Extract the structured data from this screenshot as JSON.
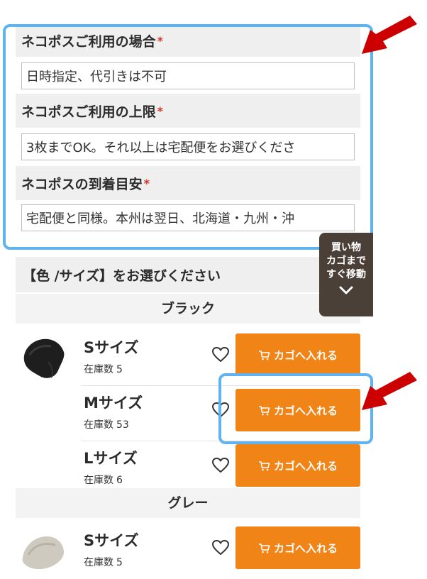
{
  "colors": {
    "accent_orange": "#f08417",
    "highlight_blue": "#5fb3f0",
    "arrow_red": "#cc0000",
    "required_star": "#d9342b",
    "float_bg": "#4a4038"
  },
  "fields": [
    {
      "label": "ネコポスご利用の場合",
      "required_mark": "*",
      "value": "日時指定、代引きは不可"
    },
    {
      "label": "ネコポスご利用の上限",
      "required_mark": "*",
      "value": "3枚までOK。それ以上は宅配便をお選びくださ"
    },
    {
      "label": "ネコポスの到着目安",
      "required_mark": "*",
      "value": "宅配便と同様。本州は翌日、北海道・九州・沖"
    }
  ],
  "floating_cart": {
    "line1": "買い物",
    "line2": "カゴまで",
    "line3": "すぐ移動",
    "icon": "chevron-down-icon"
  },
  "selection": {
    "heading": "【色 /サイズ】をお選びください",
    "groups": [
      {
        "color_name": "ブラック",
        "image": "black-beanie-thumbnail",
        "items": [
          {
            "size": "Sサイズ",
            "stock_label": "在庫数",
            "stock": "5",
            "button_label": "カゴへ入れる"
          },
          {
            "size": "Mサイズ",
            "stock_label": "在庫数",
            "stock": "53",
            "button_label": "カゴへ入れる"
          },
          {
            "size": "Lサイズ",
            "stock_label": "在庫数",
            "stock": "6",
            "button_label": "カゴへ入れる"
          }
        ]
      },
      {
        "color_name": "グレー",
        "image": "gray-beanie-thumbnail",
        "items": [
          {
            "size": "Sサイズ",
            "stock_label": "在庫数",
            "stock": "5",
            "button_label": "カゴへ入れる"
          }
        ]
      }
    ]
  }
}
